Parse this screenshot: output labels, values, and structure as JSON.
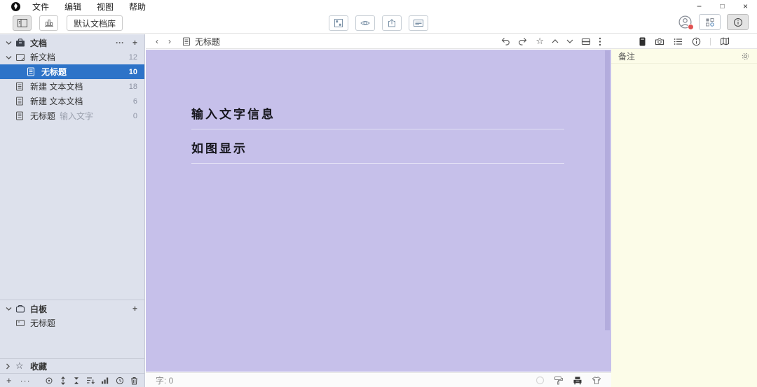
{
  "window": {
    "minimize": "−",
    "maximize": "□",
    "close": "×"
  },
  "menubar": {
    "items": [
      "文件",
      "编辑",
      "视图",
      "帮助"
    ]
  },
  "toolbar": {
    "library_label": "默认文档库"
  },
  "sidebar": {
    "docs_header": {
      "label": "文档",
      "more": "···",
      "add": "+"
    },
    "tree": [
      {
        "label": "新文档",
        "count": "12"
      },
      {
        "label": "无标题",
        "count": "10"
      },
      {
        "label": "新建 文本文档",
        "count": "18"
      },
      {
        "label": "新建 文本文档",
        "count": "6"
      },
      {
        "label": "无标题",
        "hint": "输入文字",
        "count": "0"
      }
    ],
    "board_header": {
      "label": "白板",
      "add": "+"
    },
    "board_items": [
      {
        "label": "无标题"
      }
    ],
    "favorites_header": {
      "label": "收藏",
      "star": "☆"
    },
    "bottom": {
      "add": "+",
      "more": "···"
    }
  },
  "editor": {
    "tab_title": "无标题",
    "star": "☆",
    "content_lines": [
      "输入文字信息",
      "如图显示"
    ],
    "status": {
      "word_count": "字: 0"
    }
  },
  "notes": {
    "title": "备注"
  },
  "colors": {
    "accent_blue": "#2d73c8",
    "editor_bg": "#c6c0ea",
    "notes_bg": "#fcfce8",
    "sidebar_bg": "#dde1ec"
  }
}
